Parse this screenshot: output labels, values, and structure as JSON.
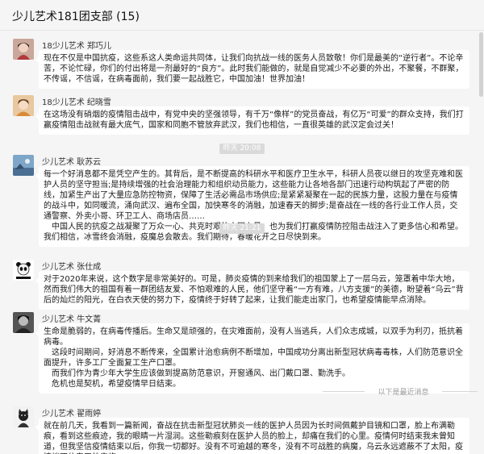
{
  "chat": {
    "title": "少儿艺术181团支部 (15)"
  },
  "timestamps": [
    "昨天 20:08",
    "昨天 21:21"
  ],
  "new_divider": "以下是最近消息",
  "messages": [
    {
      "sender": "18少儿艺术  郑巧儿",
      "avatar": "avatar-girl-red",
      "paragraphs": [
        "现在不仅是中国抗疫，这些系这人类命运共同体，让我们向抗战一线的医务人员致敬！你们是最美的“逆行者”。不论辛苦，不论忙碌，你们的付出将是一剂最好的“良方”。此时我们能做的，就是自觉减少不必要的外出，不聚餐，不群聚，不传谣，不信谣，在病毒面前，我们要一起战胜它，中国加油！世界加油！"
      ]
    },
    {
      "sender": "18少儿艺术  纪晓雪",
      "avatar": "avatar-girl-orange",
      "paragraphs": [
        "在这场没有硝烟的疫情阻击战中，有党中央的坚强领导，有千万“像样”的党员奋战，有亿万“可爱”的群众支持，我们打赢疫情阻击战就有最大底气，国家和同胞不管放弃武汉，我们也相信，一直很英雄的武汉定会过关！"
      ]
    },
    {
      "sender": "少儿艺术  耿苏云",
      "avatar": "avatar-sky-blue",
      "paragraphs": [
        "每一个好消息都不是凭空产生的。其背后，是不断提高的科研水平和医疗卫生水平，科研人员夜以继日的攻坚克难和医护人员的坚守担当;是持续增强的社会治理能力和组织动员能力，这些能力让各地各部门迅速行动构筑起了严密的防线，加紧生产出了大量应急防控物资，保障了生活必需品市场供应;是紧紧凝聚在一起的民族力量，这股力量在与疫情的战斗中，如同暖流，涌向武汉、遍布全国，加快寒冬的消融，加速春天的脚步;是奋战在一线的各行业工作人员，交通警察、外卖小哥、环卫工人、商场店员……",
        "中国人民的抗疫之战凝聚了万众一心、共克时艰的中国力量，也为我们打赢疫情防控阻击战注入了更多信心和希望。我们相信，冰雪终会消融，疫魔总会散去。我们期待，春暖花开之日尽快到来。"
      ]
    },
    {
      "sender": "少儿艺术  张仕成",
      "avatar": "avatar-panda",
      "paragraphs": [
        "对于2020年来说，这个数字是非常美好的。可是，肺炎疫情的到来给我们的祖国蒙上了一层乌云，笼罩着中华大地，然而我们伟大的祖国有着一群团结友爱、不怕艰难的人民，他们坚守着“一方有难，八方支援”的美德，盼望着“乌云”背后的灿烂的阳光，在白衣天使的努力下，疫情终于好转了起来，让我们能走出家门，也希望疫情能早点消除。"
      ]
    },
    {
      "sender": "少儿艺术  牛文菁",
      "avatar": "avatar-dark-bw",
      "paragraphs": [
        "生命是脆弱的，在病毒传播后。生命又是顽强的，在灾难面前，没有人当逃兵，人们众志成城，以双手为利刃，抵抗着病毒。",
        "这段时间期间，好消息不断传来，全国累计治愈病例不断增加，中国成功分离出新型冠状病毒毒株，人们防范意识全面提升，许多工厂全面复工生产口罩。",
        "而我们作为青少年大学生应该做到提高防范意识，开窗通风、出门戴口罩、勤洗手。",
        "危机也是契机，希望疫情早日结束。"
      ]
    },
    {
      "sender": "少儿艺术  翟雨婷",
      "avatar": "avatar-black-cat",
      "paragraphs": [
        "就在前几天，我看到一篇新闻，奋战在抗击新型冠状肺炎一线的医护人员因为长时间佩戴护目镜和口罩，脸上布满勒痕，看到这些痕迹，我的眼睛一片湿润。这些勒痕刻在医护人员的脸上，却痛在我们的心里。疫情何时结束我未曾知道，但我坚信疫情结束以后，你我一切都好。没有不可逾越的寒冬，没有不可战胜的病魔，乌云永远遮蔽不了太阳，疫情挡不住春天的来临。"
      ]
    }
  ]
}
